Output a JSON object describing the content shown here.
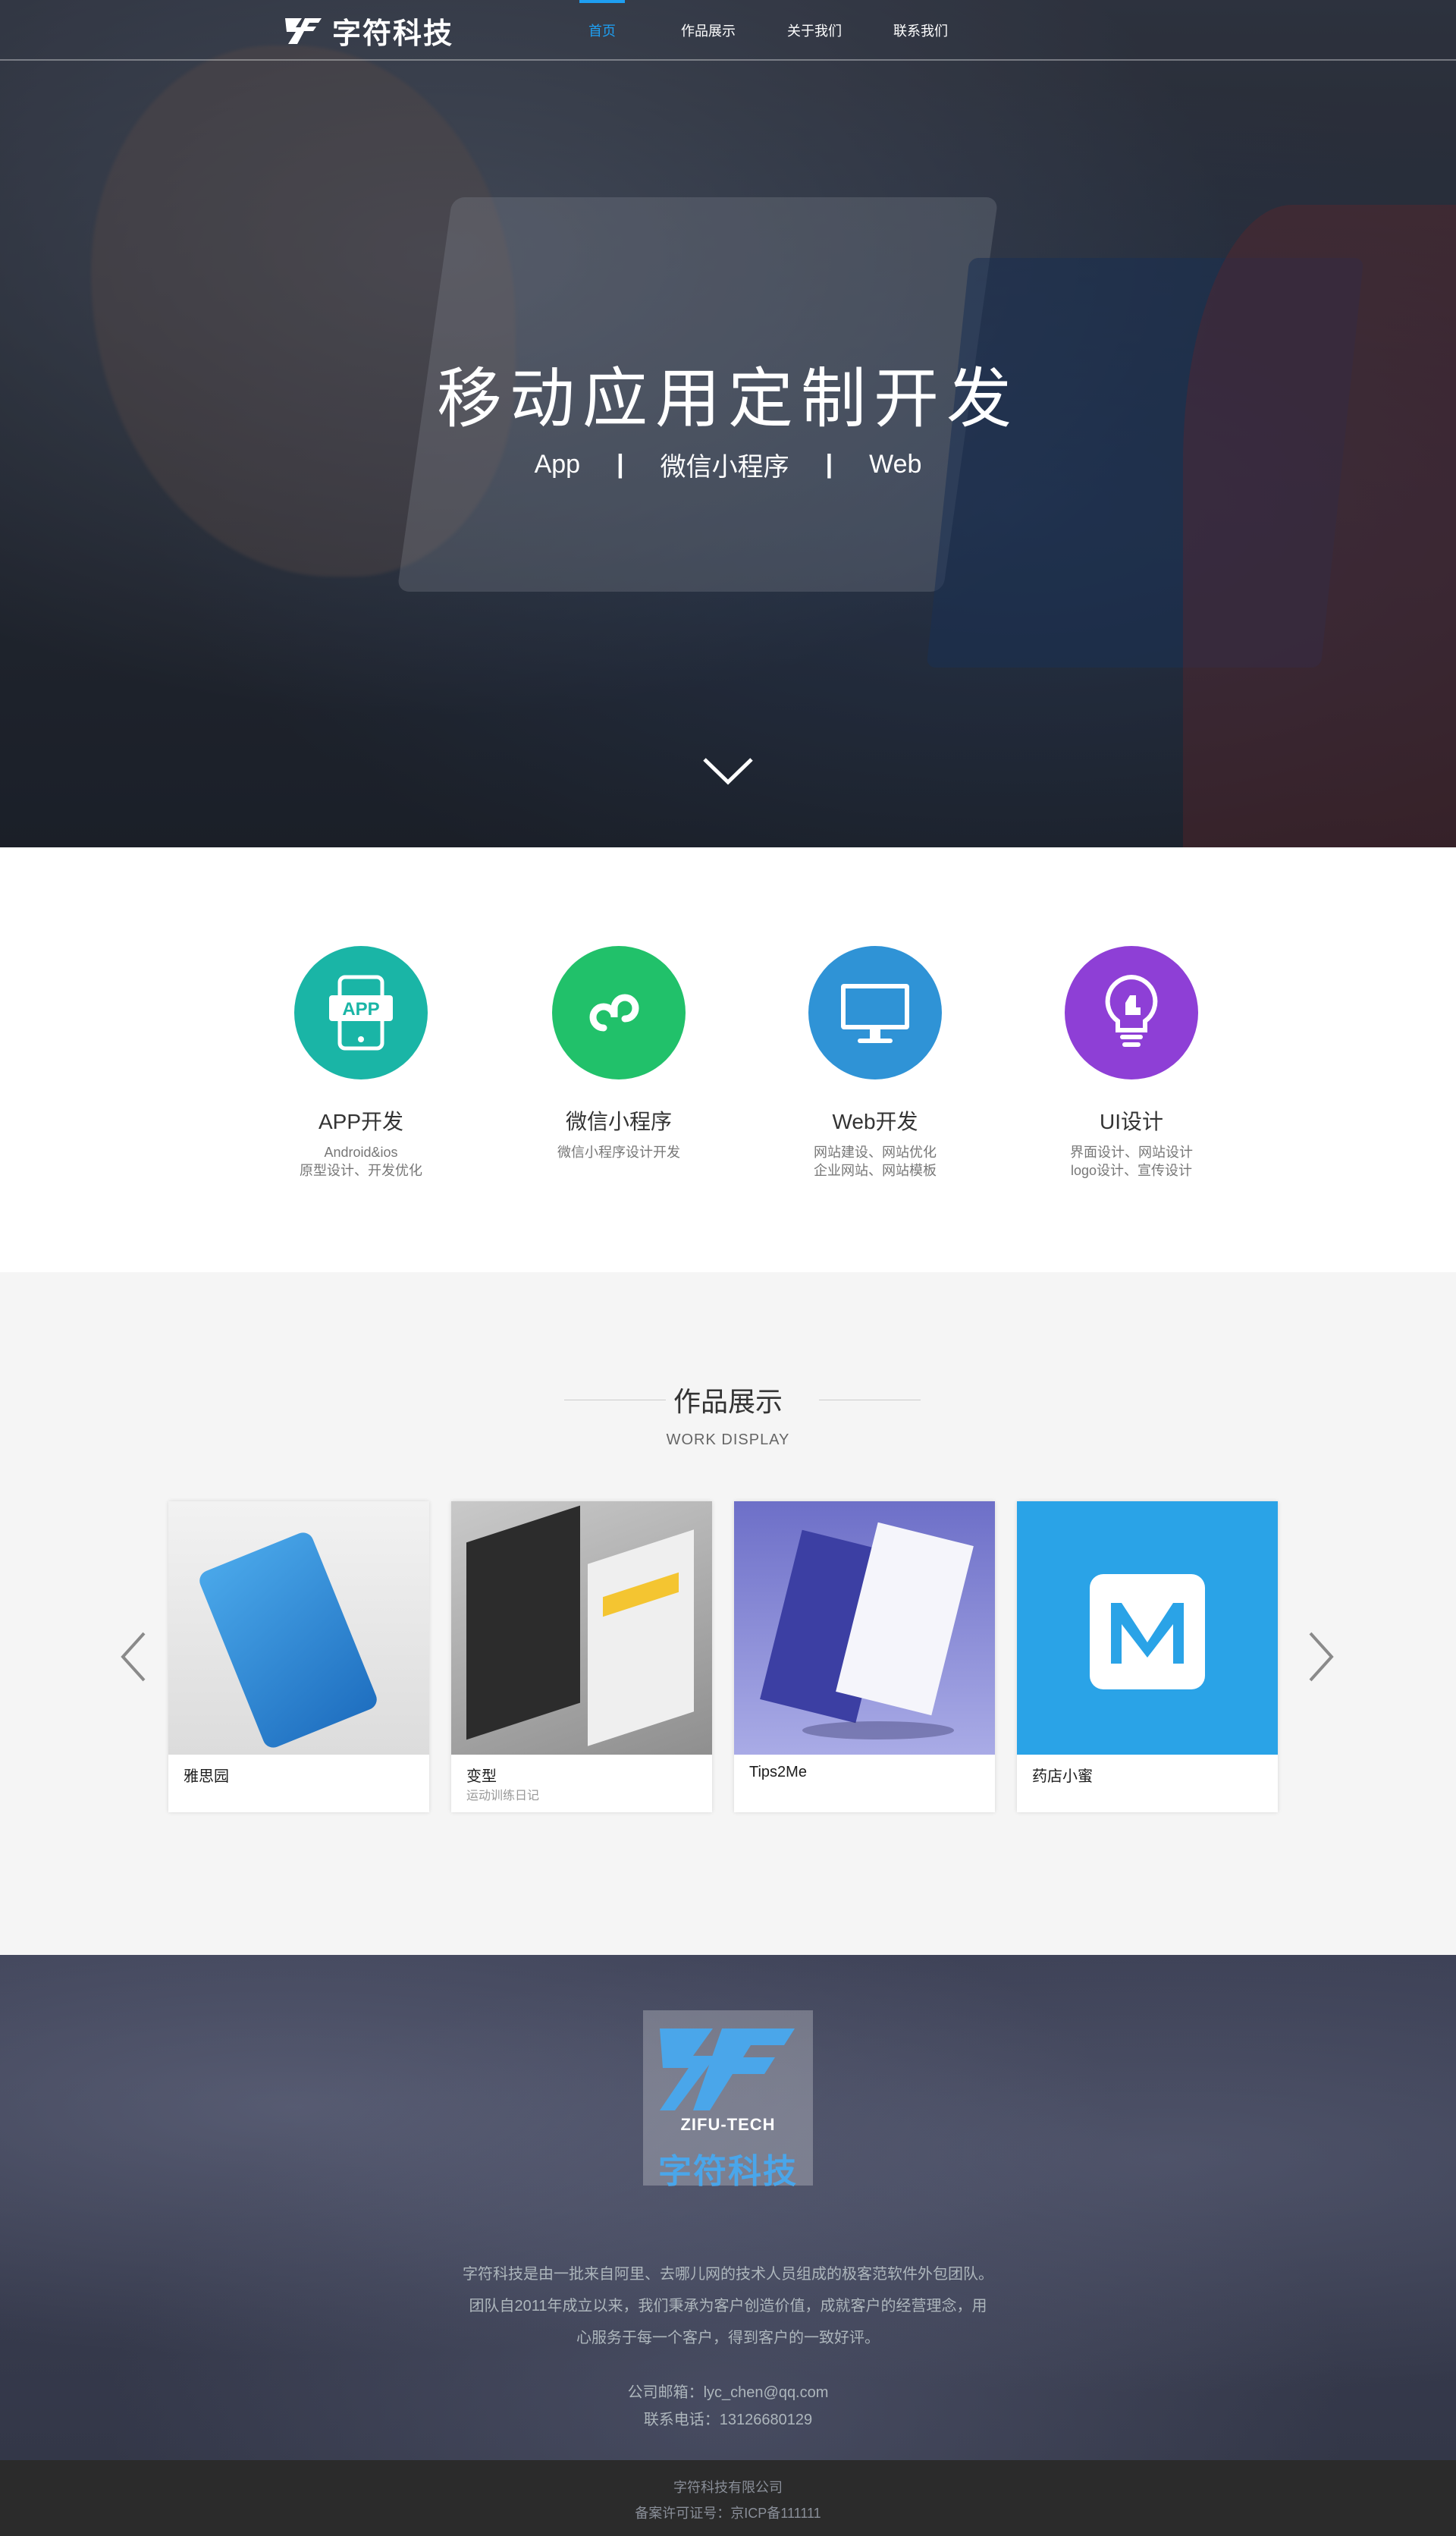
{
  "header": {
    "logo_text": "字符科技",
    "nav": [
      {
        "label": "首页",
        "active": true
      },
      {
        "label": "作品展示",
        "active": false
      },
      {
        "label": "关于我们",
        "active": false
      },
      {
        "label": "联系我们",
        "active": false
      }
    ]
  },
  "hero": {
    "title": "移动应用定制开发",
    "subtitle": [
      "App",
      "微信小程序",
      "Web"
    ],
    "separator": "|",
    "scroll_icon": "chevron-down-icon"
  },
  "services": [
    {
      "name": "APP开发",
      "desc": [
        "Android&ios",
        "原型设计、开发优化"
      ],
      "icon": "app-icon",
      "color": "#1ab5a6"
    },
    {
      "name": "微信小程序",
      "desc": [
        "微信小程序设计开发"
      ],
      "icon": "mini-program-icon",
      "color": "#21c16a"
    },
    {
      "name": "Web开发",
      "desc": [
        "网站建设、网站优化",
        "企业网站、网站模板"
      ],
      "icon": "monitor-icon",
      "color": "#2f93d6"
    },
    {
      "name": "UI设计",
      "desc": [
        "界面设计、网站设计",
        "logo设计、宣传设计"
      ],
      "icon": "lightbulb-icon",
      "color": "#8e3fd6"
    }
  ],
  "works": {
    "title": "作品展示",
    "subtitle": "WORK DISPLAY",
    "items": [
      {
        "title": "雅思园",
        "sub": ""
      },
      {
        "title": "变型",
        "sub": "运动训练日记"
      },
      {
        "title": "Tips2Me",
        "sub": ""
      },
      {
        "title": "药店小蜜",
        "sub": ""
      }
    ]
  },
  "footer": {
    "logo_en": "ZIFU-TECH",
    "logo_cn": "字符科技",
    "intro": "字符科技是由一批来自阿里、去哪儿网的技术人员组成的极客范软件外包团队。团队自2011年成立以来，我们秉承为客户创造价值，成就客户的经营理念，用心服务于每一个客户，得到客户的一致好评。",
    "email": "公司邮箱：lyc_chen@qq.com",
    "phone": "联系电话：13126680129",
    "company": "字符科技有限公司",
    "icp": "备案许可证号：京ICP备111111"
  },
  "colors": {
    "accent": "#1e9ff2",
    "works_bg": "#f5f5f5",
    "bottom_bg": "#2b2b2b"
  }
}
